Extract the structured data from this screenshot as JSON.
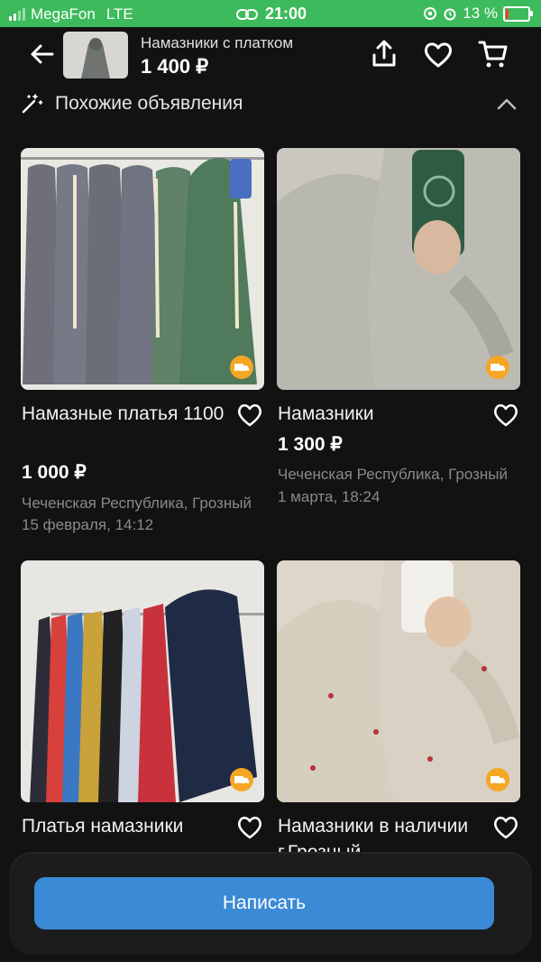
{
  "status_bar": {
    "carrier": "MegaFon",
    "network": "LTE",
    "time": "21:00",
    "battery_percent": "13 %",
    "battery_level": 0.13
  },
  "header": {
    "title": "Намазники с платком",
    "price": "1 400 ₽"
  },
  "similar": {
    "label": "Похожие объявления"
  },
  "listings": [
    {
      "title": "Намазные платья 1100",
      "price": "1 000 ₽",
      "location": "Чеченская Республика, Грозный",
      "date": "15 февраля, 14:12"
    },
    {
      "title": "Намазники",
      "price": "1 300 ₽",
      "location": "Чеченская Республика, Грозный",
      "date": "1 марта, 18:24"
    },
    {
      "title": "Платья намазники",
      "price": "",
      "location": "",
      "date": ""
    },
    {
      "title": "Намазники в наличии г.Грозный",
      "price": "",
      "location": "",
      "date": ""
    }
  ],
  "actions": {
    "write_label": "Написать"
  },
  "colors": {
    "status_bar": "#3dbb5c",
    "background": "#121212",
    "accent_button": "#3a8ad6",
    "delivery_badge": "#f5a623"
  },
  "icons": [
    "signal-icon",
    "link-icon",
    "rotation-lock-icon",
    "alarm-icon",
    "battery-icon",
    "back-arrow-icon",
    "share-icon",
    "heart-icon",
    "cart-icon",
    "magic-wand-icon",
    "chevron-up-icon",
    "delivery-truck-icon"
  ]
}
